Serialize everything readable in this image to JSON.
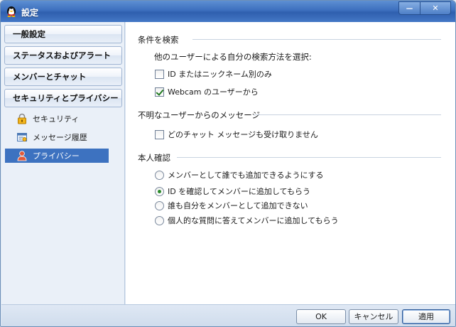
{
  "window": {
    "title": "設定",
    "minimize_label": "－",
    "close_label": "✕"
  },
  "sidebar": {
    "categories": [
      {
        "label": "一般設定"
      },
      {
        "label": "ステータスおよびアラート"
      },
      {
        "label": "メンバーとチャット"
      },
      {
        "label": "セキュリティとプライバシー"
      }
    ],
    "subitems": [
      {
        "label": "セキュリティ",
        "icon": "lock-icon"
      },
      {
        "label": "メッセージ履歴",
        "icon": "history-icon"
      },
      {
        "label": "プライバシー",
        "icon": "person-icon",
        "active": true
      }
    ]
  },
  "search": {
    "title": "条件を検索",
    "prompt": "他のユーザーによる自分の検索方法を選択:",
    "options": [
      {
        "label": "ID またはニックネーム別のみ",
        "checked": false
      },
      {
        "label": "Webcam のユーザーから",
        "checked": true
      }
    ]
  },
  "unknown": {
    "title": "不明なユーザーからのメッセージ",
    "options": [
      {
        "label": "どのチャット メッセージも受け取りません",
        "checked": false
      }
    ]
  },
  "verify": {
    "title": "本人確認",
    "options": [
      {
        "label": "メンバーとして誰でも追加できるようにする",
        "selected": false
      },
      {
        "label": "ID を確認してメンバーに追加してもらう",
        "selected": true
      },
      {
        "label": "誰も自分をメンバーとして追加できない",
        "selected": false
      },
      {
        "label": "個人的な質問に答えてメンバーに追加してもらう",
        "selected": false
      }
    ]
  },
  "buttons": {
    "ok": "OK",
    "cancel": "キャンセル",
    "apply": "適用"
  },
  "colors": {
    "titlebar": "#3c6fbe",
    "active_item": "#3d72c0",
    "check": "#217a21"
  }
}
